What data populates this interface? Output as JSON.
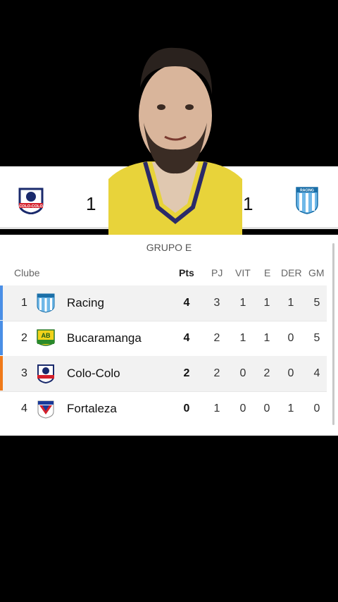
{
  "match": {
    "home_score": "1",
    "away_score": "1",
    "home_crest_label": "COLO-COLO",
    "away_crest_label": "RACING"
  },
  "standings": {
    "group_title": "GRUPO E",
    "headers": [
      "Clube",
      "Pts",
      "PJ",
      "VIT",
      "E",
      "DER",
      "GM"
    ],
    "rows": [
      {
        "pos": "1",
        "club": "Racing",
        "pts": "4",
        "pj": "3",
        "vit": "1",
        "e": "1",
        "der": "1",
        "gm": "5",
        "indicator": "#4a8fe6",
        "badge": "racing"
      },
      {
        "pos": "2",
        "club": "Bucaramanga",
        "pts": "4",
        "pj": "2",
        "vit": "1",
        "e": "1",
        "der": "0",
        "gm": "5",
        "indicator": "#4a8fe6",
        "badge": "bucaramanga"
      },
      {
        "pos": "3",
        "club": "Colo-Colo",
        "pts": "2",
        "pj": "2",
        "vit": "0",
        "e": "2",
        "der": "0",
        "gm": "4",
        "indicator": "#f07a1a",
        "badge": "colocolo"
      },
      {
        "pos": "4",
        "club": "Fortaleza",
        "pts": "0",
        "pj": "1",
        "vit": "0",
        "e": "0",
        "der": "1",
        "gm": "0",
        "indicator": "",
        "badge": "fortaleza"
      }
    ]
  },
  "badge_text": {
    "racing": "RACING",
    "bucaramanga": "AB",
    "fortaleza": "FORTALEZA"
  }
}
